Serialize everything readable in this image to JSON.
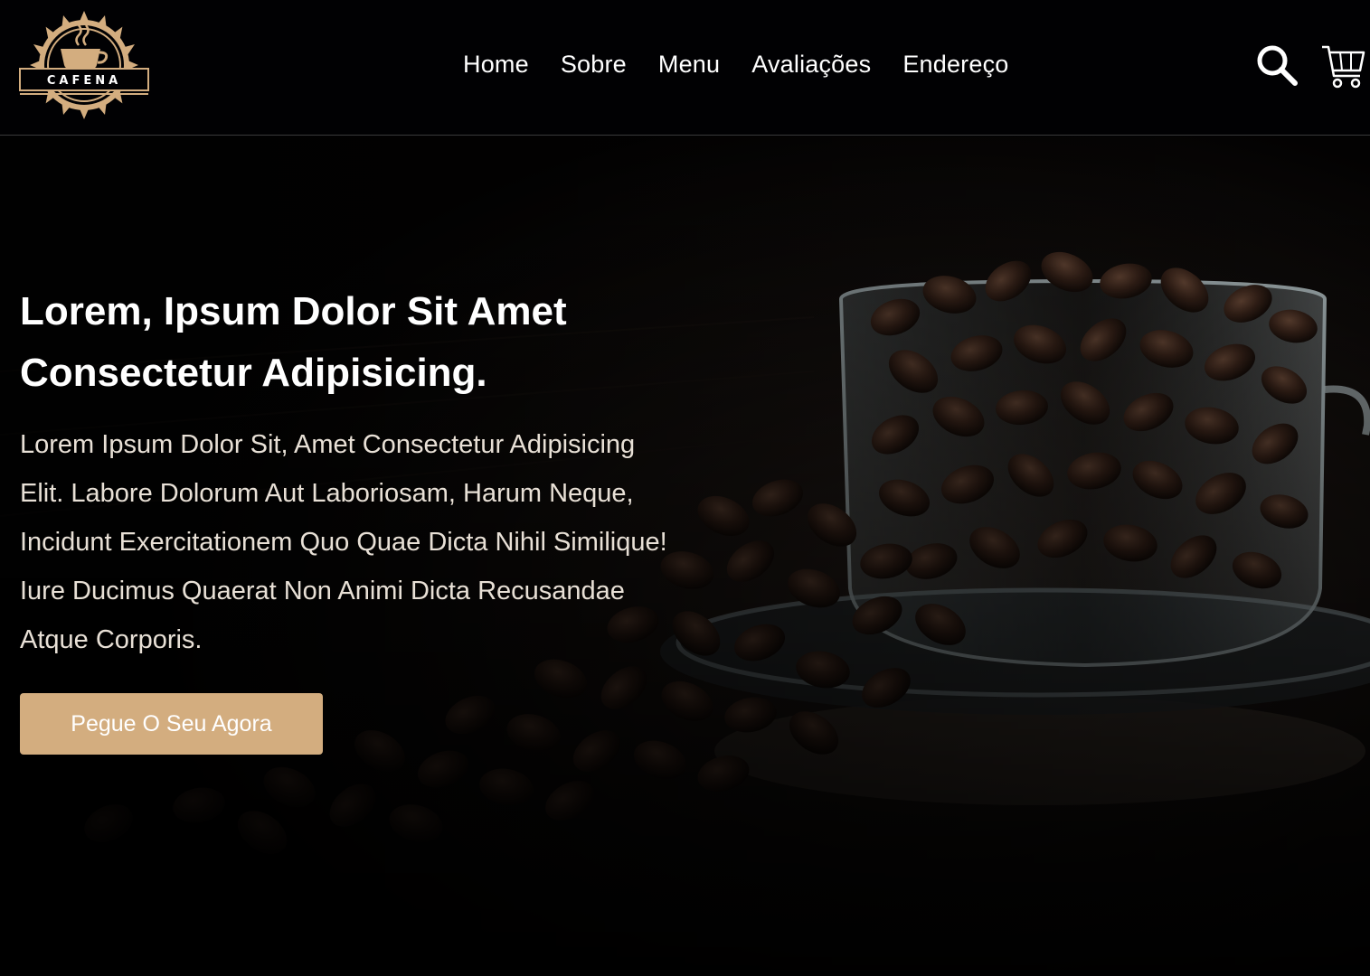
{
  "brand": {
    "logo_text": "CAFENA",
    "accent_color": "#d3ad7f",
    "background_color": "#010103"
  },
  "nav": {
    "items": [
      {
        "label": "Home"
      },
      {
        "label": "Sobre"
      },
      {
        "label": "Menu"
      },
      {
        "label": "Avaliações"
      },
      {
        "label": "Endereço"
      }
    ]
  },
  "header_icons": {
    "search": "search-icon",
    "cart": "cart-icon"
  },
  "hero": {
    "title": "Lorem, Ipsum Dolor Sit Amet Consectetur Adipisicing.",
    "text": "Lorem Ipsum Dolor Sit, Amet Consectetur Adipisicing Elit. Labore Dolorum Aut Laboriosam, Harum Neque, Incidunt Exercitationem Quo Quae Dicta Nihil Similique! Iure Ducimus Quaerat Non Animi Dicta Recusandae Atque Corporis.",
    "cta_label": "Pegue O Seu Agora",
    "background_image": "coffee-beans-in-glass-cup"
  }
}
